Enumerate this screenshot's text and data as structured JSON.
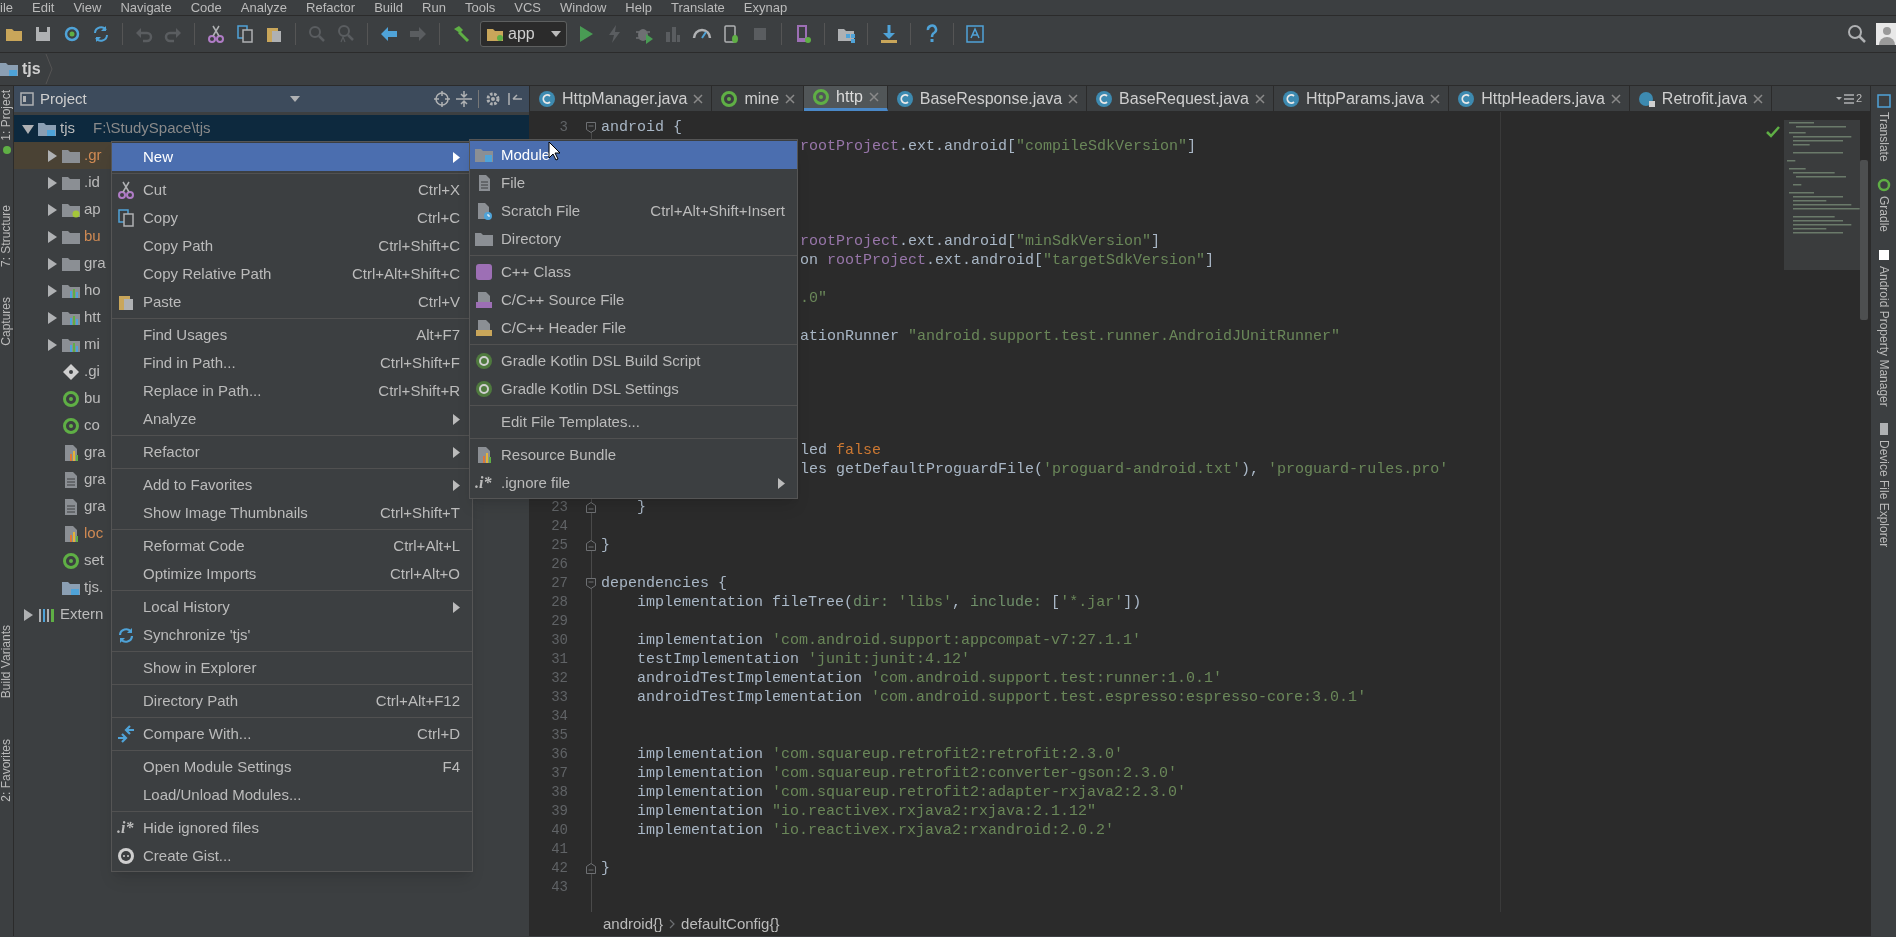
{
  "menu_bar": [
    "ile",
    "Edit",
    "View",
    "Navigate",
    "Code",
    "Analyze",
    "Refactor",
    "Build",
    "Run",
    "Tools",
    "VCS",
    "Window",
    "Help",
    "Translate",
    "Exynap"
  ],
  "toolbar": {
    "run_config": "app"
  },
  "nav_bar": {
    "crumbs": [
      "tjs"
    ]
  },
  "left_strip": [
    "1: Project",
    "7: Structure",
    "Captures",
    "Build Variants",
    "2: Favorites"
  ],
  "project_panel": {
    "title": "Project",
    "tree": [
      {
        "label": "tjs",
        "path": "F:\\StudySpace\\tjs",
        "kind": "project-folder",
        "expanded": true,
        "selected": true,
        "highlighted": false,
        "ignored": false,
        "children": [
          {
            "label": ".gr",
            "kind": "folder",
            "expanded": false,
            "selected": false,
            "highlighted": true,
            "ignored": true
          },
          {
            "label": ".id",
            "kind": "folder",
            "expanded": false,
            "selected": false,
            "highlighted": false,
            "ignored": false
          },
          {
            "label": "ap",
            "kind": "android-module",
            "expanded": false,
            "selected": false,
            "highlighted": false,
            "ignored": false
          },
          {
            "label": "bu",
            "kind": "folder",
            "expanded": false,
            "selected": false,
            "highlighted": false,
            "ignored": true
          },
          {
            "label": "gra",
            "kind": "folder",
            "expanded": false,
            "selected": false,
            "highlighted": false,
            "ignored": false
          },
          {
            "label": "ho",
            "kind": "module",
            "expanded": false,
            "selected": false,
            "highlighted": false,
            "ignored": false
          },
          {
            "label": "htt",
            "kind": "module",
            "expanded": false,
            "selected": false,
            "highlighted": false,
            "ignored": false
          },
          {
            "label": "mi",
            "kind": "module",
            "expanded": false,
            "selected": false,
            "highlighted": false,
            "ignored": false
          },
          {
            "label": ".gi",
            "kind": "git-file",
            "selected": false,
            "highlighted": false,
            "ignored": false
          },
          {
            "label": "bu",
            "kind": "gradle",
            "selected": false,
            "highlighted": false,
            "ignored": false
          },
          {
            "label": "co",
            "kind": "gradle",
            "selected": false,
            "highlighted": false,
            "ignored": false
          },
          {
            "label": "gra",
            "kind": "chart-file",
            "selected": false,
            "highlighted": false,
            "ignored": false
          },
          {
            "label": "gra",
            "kind": "text-file",
            "selected": false,
            "highlighted": false,
            "ignored": false
          },
          {
            "label": "gra",
            "kind": "text-file",
            "selected": false,
            "highlighted": false,
            "ignored": false
          },
          {
            "label": "loc",
            "kind": "chart-file",
            "selected": false,
            "highlighted": false,
            "ignored": true
          },
          {
            "label": "set",
            "kind": "gradle",
            "selected": false,
            "highlighted": false,
            "ignored": false
          },
          {
            "label": "tjs.",
            "kind": "project-file",
            "selected": false,
            "highlighted": false,
            "ignored": false
          }
        ]
      },
      {
        "label": "Extern",
        "kind": "libraries",
        "expanded": false,
        "selected": false,
        "highlighted": false,
        "ignored": false
      }
    ]
  },
  "context_menu": {
    "items": [
      {
        "kind": "item",
        "label": "New",
        "submenu": true,
        "selected": true
      },
      {
        "kind": "separator"
      },
      {
        "kind": "item",
        "label": "Cut",
        "shortcut": "Ctrl+X",
        "submenu": false,
        "selected": false
      },
      {
        "kind": "item",
        "label": "Copy",
        "shortcut": "Ctrl+C",
        "submenu": false,
        "selected": false
      },
      {
        "kind": "item",
        "label": "Copy Path",
        "shortcut": "Ctrl+Shift+C",
        "submenu": false,
        "selected": false
      },
      {
        "kind": "item",
        "label": "Copy Relative Path",
        "shortcut": "Ctrl+Alt+Shift+C",
        "submenu": false,
        "selected": false
      },
      {
        "kind": "item",
        "label": "Paste",
        "shortcut": "Ctrl+V",
        "submenu": false,
        "selected": false
      },
      {
        "kind": "separator"
      },
      {
        "kind": "item",
        "label": "Find Usages",
        "shortcut": "Alt+F7",
        "submenu": false,
        "selected": false
      },
      {
        "kind": "item",
        "label": "Find in Path...",
        "shortcut": "Ctrl+Shift+F",
        "submenu": false,
        "selected": false
      },
      {
        "kind": "item",
        "label": "Replace in Path...",
        "shortcut": "Ctrl+Shift+R",
        "submenu": false,
        "selected": false
      },
      {
        "kind": "item",
        "label": "Analyze",
        "submenu": true,
        "selected": false
      },
      {
        "kind": "separator"
      },
      {
        "kind": "item",
        "label": "Refactor",
        "submenu": true,
        "selected": false
      },
      {
        "kind": "separator"
      },
      {
        "kind": "item",
        "label": "Add to Favorites",
        "submenu": true,
        "selected": false
      },
      {
        "kind": "item",
        "label": "Show Image Thumbnails",
        "shortcut": "Ctrl+Shift+T",
        "submenu": false,
        "selected": false
      },
      {
        "kind": "separator"
      },
      {
        "kind": "item",
        "label": "Reformat Code",
        "shortcut": "Ctrl+Alt+L",
        "submenu": false,
        "selected": false
      },
      {
        "kind": "item",
        "label": "Optimize Imports",
        "shortcut": "Ctrl+Alt+O",
        "submenu": false,
        "selected": false
      },
      {
        "kind": "separator"
      },
      {
        "kind": "item",
        "label": "Local History",
        "submenu": true,
        "selected": false
      },
      {
        "kind": "item",
        "label": "Synchronize 'tjs'",
        "submenu": false,
        "selected": false
      },
      {
        "kind": "separator"
      },
      {
        "kind": "item",
        "label": "Show in Explorer",
        "submenu": false,
        "selected": false
      },
      {
        "kind": "separator"
      },
      {
        "kind": "item",
        "label": "Directory Path",
        "shortcut": "Ctrl+Alt+F12",
        "submenu": false,
        "selected": false
      },
      {
        "kind": "separator"
      },
      {
        "kind": "item",
        "label": "Compare With...",
        "shortcut": "Ctrl+D",
        "submenu": false,
        "selected": false
      },
      {
        "kind": "separator"
      },
      {
        "kind": "item",
        "label": "Open Module Settings",
        "shortcut": "F4",
        "submenu": false,
        "selected": false
      },
      {
        "kind": "item",
        "label": "Load/Unload Modules...",
        "submenu": false,
        "selected": false
      },
      {
        "kind": "separator"
      },
      {
        "kind": "item",
        "glyph": ".i*",
        "label": "Hide ignored files",
        "submenu": false,
        "selected": false
      },
      {
        "kind": "item",
        "label": "Create Gist...",
        "submenu": false,
        "selected": false
      }
    ]
  },
  "submenu": {
    "items": [
      {
        "kind": "item",
        "label": "Module",
        "submenu": false,
        "selected": true
      },
      {
        "kind": "item",
        "label": "File",
        "submenu": false,
        "selected": false
      },
      {
        "kind": "item",
        "label": "Scratch File",
        "shortcut": "Ctrl+Alt+Shift+Insert",
        "submenu": false,
        "selected": false
      },
      {
        "kind": "item",
        "label": "Directory",
        "submenu": false,
        "selected": false
      },
      {
        "kind": "separator"
      },
      {
        "kind": "item",
        "label": "C++ Class",
        "submenu": false,
        "selected": false
      },
      {
        "kind": "item",
        "label": "C/C++ Source File",
        "submenu": false,
        "selected": false
      },
      {
        "kind": "item",
        "label": "C/C++ Header File",
        "submenu": false,
        "selected": false
      },
      {
        "kind": "separator"
      },
      {
        "kind": "item",
        "label": "Gradle Kotlin DSL Build Script",
        "submenu": false,
        "selected": false
      },
      {
        "kind": "item",
        "label": "Gradle Kotlin DSL Settings",
        "submenu": false,
        "selected": false
      },
      {
        "kind": "separator"
      },
      {
        "kind": "item",
        "label": "Edit File Templates...",
        "submenu": false,
        "selected": false
      },
      {
        "kind": "separator"
      },
      {
        "kind": "item",
        "label": "Resource Bundle",
        "submenu": false,
        "selected": false
      },
      {
        "kind": "item",
        "glyph": ".i*",
        "label": ".ignore file",
        "submenu": true,
        "selected": false
      }
    ]
  },
  "tabs": [
    {
      "label": "HttpManager.java",
      "kind": "class",
      "selected": false
    },
    {
      "label": "mine",
      "kind": "gradle",
      "selected": false
    },
    {
      "label": "http",
      "kind": "gradle",
      "selected": true
    },
    {
      "label": "BaseResponse.java",
      "kind": "class",
      "selected": false
    },
    {
      "label": "BaseRequest.java",
      "kind": "class",
      "selected": false
    },
    {
      "label": "HttpParams.java",
      "kind": "class",
      "selected": false
    },
    {
      "label": "HttpHeaders.java",
      "kind": "class",
      "selected": false
    },
    {
      "label": "Retrofit.java",
      "kind": "library-class",
      "selected": false
    }
  ],
  "tab_overflow_count": "2",
  "editor": {
    "lines": [
      {
        "number": "3",
        "kind": "fold-start",
        "code": [
          {
            "kind": "plain",
            "text": "android {"
          }
        ]
      },
      {
        "kind": "covered",
        "code": [
          {
            "kind": "field",
            "text": "rootProject"
          },
          {
            "kind": "plain",
            "text": ".ext.android["
          },
          {
            "kind": "string",
            "text": "\"compileSdkVersion\""
          },
          {
            "kind": "plain",
            "text": "]"
          }
        ]
      },
      {
        "kind": "covered"
      },
      {
        "kind": "covered"
      },
      {
        "kind": "covered"
      },
      {
        "kind": "covered"
      },
      {
        "kind": "covered",
        "code": [
          {
            "kind": "field",
            "text": "rootProject"
          },
          {
            "kind": "plain",
            "text": ".ext.android["
          },
          {
            "kind": "string",
            "text": "\"minSdkVersion\""
          },
          {
            "kind": "plain",
            "text": "]"
          }
        ]
      },
      {
        "kind": "covered",
        "code": [
          {
            "kind": "plain",
            "text": "on "
          },
          {
            "kind": "field",
            "text": "rootProject"
          },
          {
            "kind": "plain",
            "text": ".ext.android["
          },
          {
            "kind": "string",
            "text": "\"targetSdkVersion\""
          },
          {
            "kind": "plain",
            "text": "]"
          }
        ]
      },
      {
        "kind": "covered"
      },
      {
        "kind": "covered",
        "code": [
          {
            "kind": "string",
            "text": ".0\""
          }
        ]
      },
      {
        "kind": "covered"
      },
      {
        "kind": "covered",
        "code": [
          {
            "kind": "plain",
            "text": "ationRunner "
          },
          {
            "kind": "string",
            "text": "\"android.support.test.runner.AndroidJUnitRunner\""
          }
        ]
      },
      {
        "kind": "covered"
      },
      {
        "kind": "covered"
      },
      {
        "kind": "covered"
      },
      {
        "kind": "covered"
      },
      {
        "kind": "covered"
      },
      {
        "kind": "covered",
        "code": [
          {
            "kind": "plain",
            "text": "led "
          },
          {
            "kind": "keyword",
            "text": "false"
          }
        ]
      },
      {
        "kind": "covered",
        "code": [
          {
            "kind": "plain",
            "text": "les getDefaultProguardFile("
          },
          {
            "kind": "string",
            "text": "'proguard-android.txt'"
          },
          {
            "kind": "plain",
            "text": "), "
          },
          {
            "kind": "string",
            "text": "'proguard-rules.pro'"
          }
        ]
      },
      {
        "kind": "covered"
      },
      {
        "number": "23",
        "kind": "fold-end",
        "code": [
          {
            "kind": "plain",
            "text": "    }"
          }
        ]
      },
      {
        "number": "24",
        "kind": "line"
      },
      {
        "number": "25",
        "kind": "fold-end",
        "code": [
          {
            "kind": "plain",
            "text": "}"
          }
        ]
      },
      {
        "number": "26",
        "kind": "line"
      },
      {
        "number": "27",
        "kind": "fold-start",
        "code": [
          {
            "kind": "plain",
            "text": "dependencies {"
          }
        ]
      },
      {
        "number": "28",
        "kind": "line",
        "code": [
          {
            "kind": "plain",
            "text": "    implementation fileTree("
          },
          {
            "kind": "param",
            "text": "dir: "
          },
          {
            "kind": "string",
            "text": "'libs'"
          },
          {
            "kind": "plain",
            "text": ", "
          },
          {
            "kind": "param",
            "text": "include: "
          },
          {
            "kind": "plain",
            "text": "["
          },
          {
            "kind": "string",
            "text": "'*.jar'"
          },
          {
            "kind": "plain",
            "text": "])"
          }
        ]
      },
      {
        "number": "29",
        "kind": "line"
      },
      {
        "number": "30",
        "kind": "line",
        "code": [
          {
            "kind": "plain",
            "text": "    implementation "
          },
          {
            "kind": "string",
            "text": "'com.android.support:appcompat-v7:27.1.1'"
          }
        ]
      },
      {
        "number": "31",
        "kind": "line",
        "code": [
          {
            "kind": "plain",
            "text": "    testImplementation "
          },
          {
            "kind": "string",
            "text": "'junit:junit:4.12'"
          }
        ]
      },
      {
        "number": "32",
        "kind": "line",
        "code": [
          {
            "kind": "plain",
            "text": "    androidTestImplementation "
          },
          {
            "kind": "string",
            "text": "'com.android.support.test:runner:1.0.1'"
          }
        ]
      },
      {
        "number": "33",
        "kind": "line",
        "code": [
          {
            "kind": "plain",
            "text": "    androidTestImplementation "
          },
          {
            "kind": "string",
            "text": "'com.android.support.test.espresso:espresso-core:3.0.1'"
          }
        ]
      },
      {
        "number": "34",
        "kind": "line"
      },
      {
        "number": "35",
        "kind": "line"
      },
      {
        "number": "36",
        "kind": "line",
        "code": [
          {
            "kind": "plain",
            "text": "    implementation "
          },
          {
            "kind": "string",
            "text": "'com.squareup.retrofit2:retrofit:2.3.0'"
          }
        ]
      },
      {
        "number": "37",
        "kind": "line",
        "code": [
          {
            "kind": "plain",
            "text": "    implementation "
          },
          {
            "kind": "string",
            "text": "'com.squareup.retrofit2:converter-gson:2.3.0'"
          }
        ]
      },
      {
        "number": "38",
        "kind": "line",
        "code": [
          {
            "kind": "plain",
            "text": "    implementation "
          },
          {
            "kind": "string",
            "text": "'com.squareup.retrofit2:adapter-rxjava2:2.3.0'"
          }
        ]
      },
      {
        "number": "39",
        "kind": "line",
        "code": [
          {
            "kind": "plain",
            "text": "    implementation "
          },
          {
            "kind": "string",
            "text": "\"io.reactivex.rxjava2:rxjava:2.1.12\""
          }
        ]
      },
      {
        "number": "40",
        "kind": "line",
        "code": [
          {
            "kind": "plain",
            "text": "    implementation "
          },
          {
            "kind": "string",
            "text": "'io.reactivex.rxjava2:rxandroid:2.0.2'"
          }
        ]
      },
      {
        "number": "41",
        "kind": "line"
      },
      {
        "number": "42",
        "kind": "fold-end",
        "code": [
          {
            "kind": "plain",
            "text": "}"
          }
        ]
      },
      {
        "number": "43",
        "kind": "line"
      }
    ],
    "breadcrumb": [
      "android{}",
      "defaultConfig{}"
    ]
  },
  "right_strip": [
    "Translate",
    "Gradle",
    "Android Property Manager",
    "Device File Explorer"
  ]
}
